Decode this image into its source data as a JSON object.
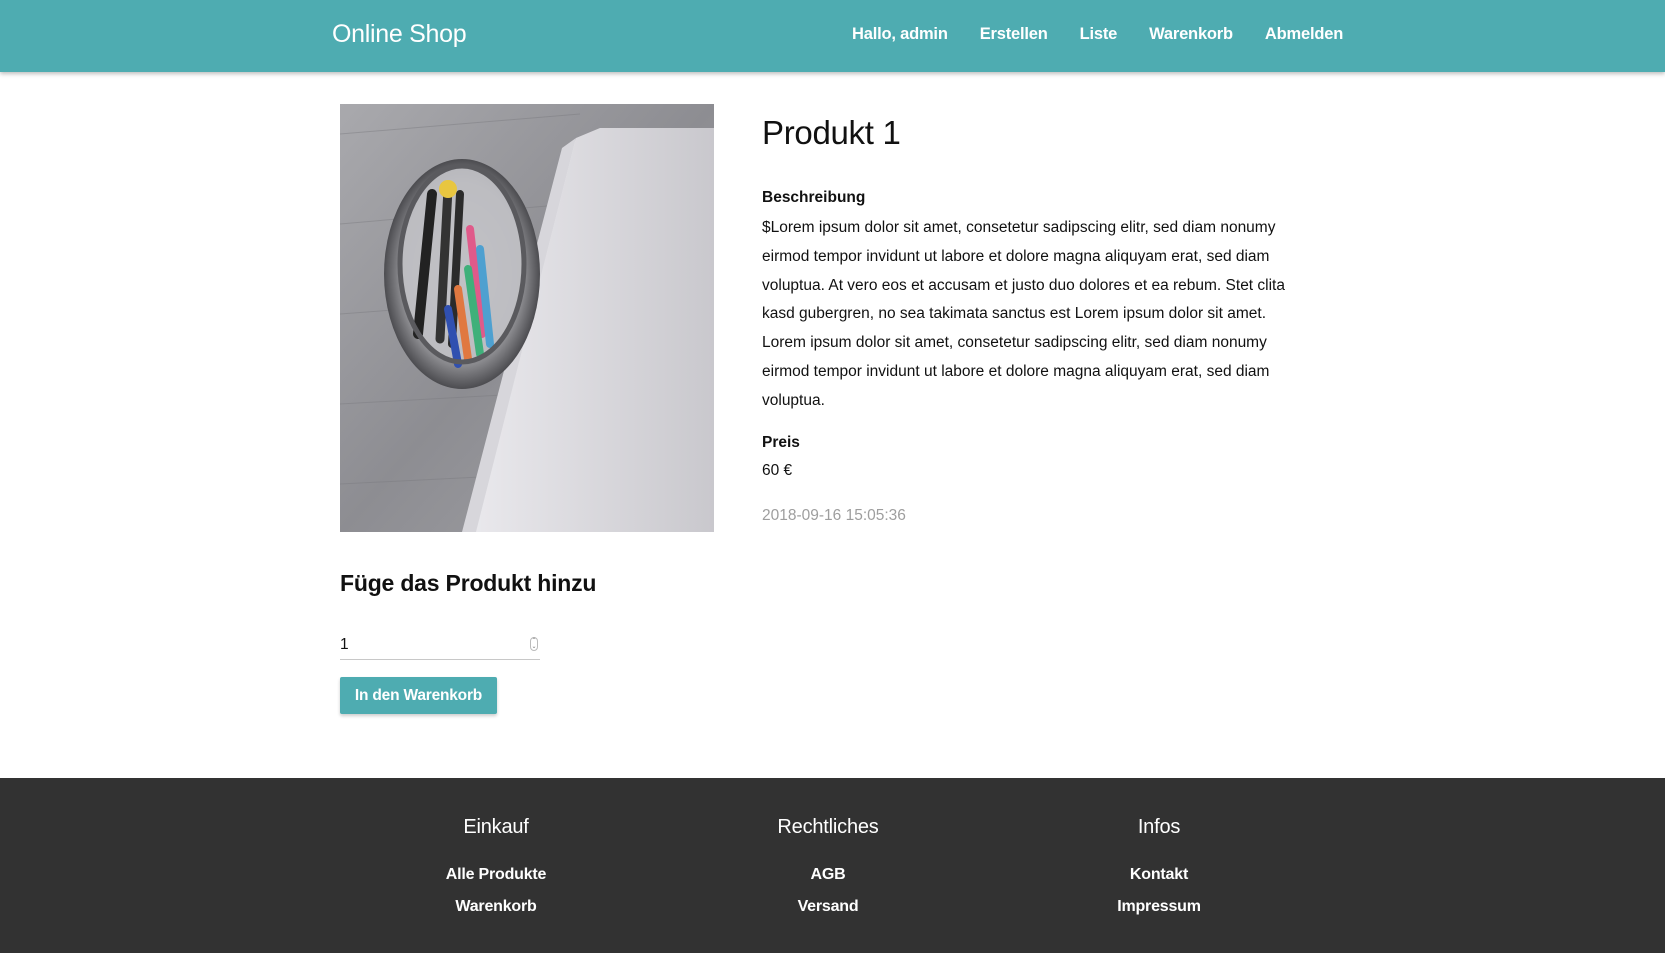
{
  "header": {
    "brand": "Online Shop",
    "nav": [
      "Hallo, admin",
      "Erstellen",
      "Liste",
      "Warenkorb",
      "Abmelden"
    ]
  },
  "product": {
    "title": "Produkt 1",
    "description_label": "Beschreibung",
    "description": "$Lorem ipsum dolor sit amet, consetetur sadipscing elitr, sed diam nonumy eirmod tempor invidunt ut labore et dolore magna aliquyam erat, sed diam voluptua. At vero eos et accusam et justo duo dolores et ea rebum. Stet clita kasd gubergren, no sea takimata sanctus est Lorem ipsum dolor sit amet. Lorem ipsum dolor sit amet, consetetur sadipscing elitr, sed diam nonumy eirmod tempor invidunt ut labore et dolore magna aliquyam erat, sed diam voluptua.",
    "price_label": "Preis",
    "price": "60 €",
    "timestamp": "2018-09-16 15:05:36",
    "image_icon": "pencil-cup-notebook-photo"
  },
  "add_to_cart": {
    "heading": "Füge das Produkt hinzu",
    "quantity": "1",
    "button_label": "In den Warenkorb"
  },
  "footer": {
    "columns": [
      {
        "title": "Einkauf",
        "links": [
          "Alle Produkte",
          "Warenkorb"
        ]
      },
      {
        "title": "Rechtliches",
        "links": [
          "AGB",
          "Versand"
        ]
      },
      {
        "title": "Infos",
        "links": [
          "Kontakt",
          "Impressum"
        ]
      }
    ]
  },
  "colors": {
    "primary": "#4eacb1",
    "footer_bg": "#323232",
    "muted_text": "#9e9e9e"
  }
}
